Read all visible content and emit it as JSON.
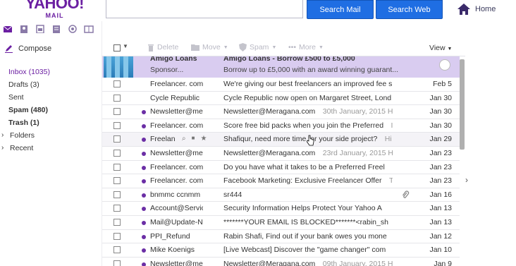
{
  "header": {
    "logo_line1": "YAHOO!",
    "logo_line2": "MAIL",
    "search_value": "",
    "search_mail_label": "Search Mail",
    "search_web_label": "Search Web",
    "home_label": "Home"
  },
  "app_icons": [
    "mail-icon",
    "contacts-icon",
    "calendar-icon",
    "notepad-icon",
    "messenger-icon",
    "newsfeed-icon"
  ],
  "sidebar": {
    "compose_label": "Compose",
    "items": [
      {
        "label": "Inbox (1035)"
      },
      {
        "label": "Drafts (3)"
      },
      {
        "label": "Sent"
      },
      {
        "label": "Spam (480)"
      },
      {
        "label": "Trash (1)"
      },
      {
        "label": "Folders"
      },
      {
        "label": "Recent"
      }
    ]
  },
  "toolbar": {
    "delete_label": "Delete",
    "move_label": "Move",
    "spam_label": "Spam",
    "more_label": "More",
    "view_label": "View"
  },
  "ad": {
    "sender": "Amigo Loans",
    "sponsor": "Sponsor...",
    "subject": "Amigo Loans - Borrow £500 to £5,000",
    "body": "Borrow up to £5,000 with an award winning guarant..."
  },
  "messages": [
    {
      "from": "Freelancer. com",
      "subject": "We're giving our best freelancers an improved fee s",
      "preview": "\\",
      "date": "Feb 5",
      "unread": false
    },
    {
      "from": "Cycle Republic",
      "subject": "Cycle Republic now open on Margaret Street, Lond",
      "preview": "\\",
      "date": "Jan 30",
      "unread": false
    },
    {
      "from": "Newsletter@me",
      "subject": "Newsletter@Meragana.com",
      "preview": "30th January, 2015 Hi, ",
      "date": "Jan 30",
      "unread": true
    },
    {
      "from": "Freelancer. com",
      "subject": "Score free bid packs when you join the Preferred",
      "preview": "I",
      "date": "Jan 30",
      "unread": true
    },
    {
      "from": "Freelan",
      "subject": "Shafiqur, need more time for your side project?",
      "preview": "Hi",
      "date": "Jan 29",
      "unread": true
    },
    {
      "from": "Newsletter@me",
      "subject": "Newsletter@Meragana.com",
      "preview": "23rd January, 2015 Hi, ",
      "date": "Jan 23",
      "unread": true
    },
    {
      "from": "Freelancer. com",
      "subject": "Do you have what it takes to be a Preferred Freel",
      "preview": "",
      "date": "Jan 23",
      "unread": true
    },
    {
      "from": "Freelancer. com",
      "subject": "Facebook Marketing: Exclusive Freelancer Offer",
      "preview": "Th",
      "date": "Jan 23",
      "unread": true
    },
    {
      "from": "bnmmc ccnmm",
      "subject": "sr444",
      "preview": "",
      "date": "Jan 16",
      "unread": true
    },
    {
      "from": "Account@Servic",
      "subject": "Security Information Helps Protect Your Yahoo A",
      "preview": "",
      "date": "Jan 13",
      "unread": true
    },
    {
      "from": "Mail@Update-N",
      "subject": "*******YOUR EMAIL IS BLOCKED*******<rabin_sh",
      "preview": "\\",
      "date": "Jan 13",
      "unread": true
    },
    {
      "from": "PPI_Refund",
      "subject": "Rabin Shafi, Find out if your bank owes you mone",
      "preview": "I",
      "date": "Jan 12",
      "unread": true
    },
    {
      "from": "Mike Koenigs",
      "subject": "[Live Webcast] Discover the \"game changer\" com",
      "preview": "",
      "date": "Jan 10",
      "unread": true
    },
    {
      "from": "Newsletter@me",
      "subject": "Newsletter@Meragana.com",
      "preview": "09th January, 2015 Hi, ",
      "date": "Jan 9",
      "unread": true
    }
  ],
  "colors": {
    "brand": "#6b1fa2",
    "button_blue": "#1f6ee3",
    "ad_background": "#d9ccf0",
    "unread_dot": "#6b2ea5"
  }
}
